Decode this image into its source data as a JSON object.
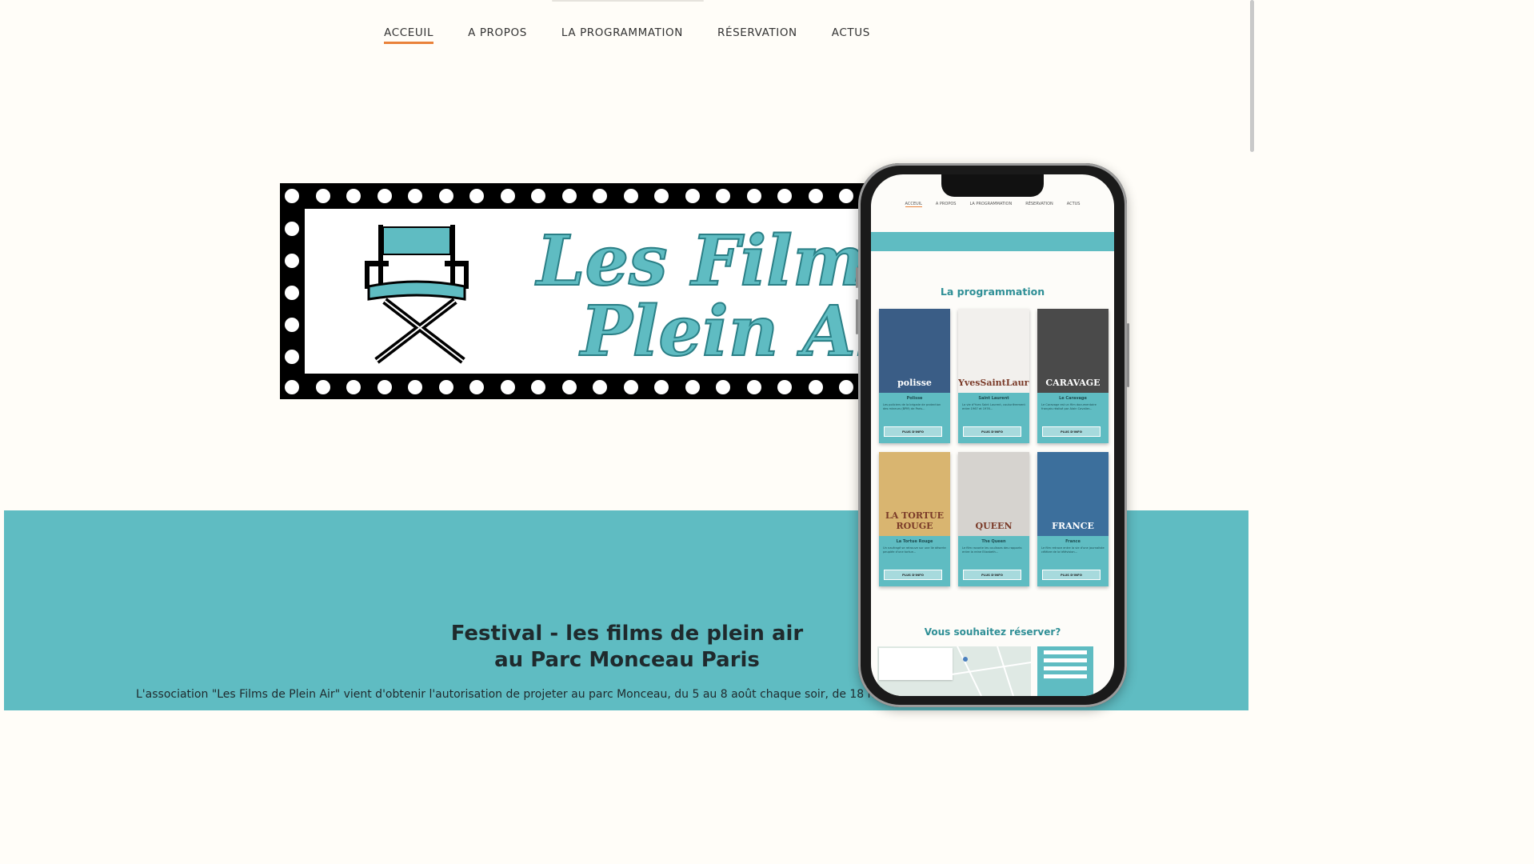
{
  "nav": {
    "items": [
      {
        "label": "ACCEUIL"
      },
      {
        "label": "A PROPOS"
      },
      {
        "label": "LA PROGRAMMATION"
      },
      {
        "label": "RÉSERVATION"
      },
      {
        "label": "ACTUS"
      }
    ]
  },
  "banner": {
    "line1": "Les Films",
    "line2": "Plein Air"
  },
  "hero": {
    "title_line1": "Festival - les films de plein air",
    "title_line2": "au Parc Monceau Paris",
    "intro": "L'association \"Les Films de Plein Air\" vient d'obtenir l'autorisation de projeter au parc Monceau, du 5 au 8 août chaque soir, de 18 h à minuit"
  },
  "mockup": {
    "nav": [
      "ACCEUIL",
      "A PROPOS",
      "LA PROGRAMMATION",
      "RÉSERVATION",
      "ACTUS"
    ],
    "section_title": "La programmation",
    "button_label": "PLUS D'INFO",
    "films": [
      {
        "title": "Polisse",
        "poster_text": "polisse",
        "bg": "#3a5d86",
        "desc": "Les policiers de la brigade de protection des mineurs (BPM) de Paris..."
      },
      {
        "title": "Saint Laurent",
        "poster_text": "YvesSaintLaurent",
        "bg": "#f2f0ed",
        "desc": "La vie d'Yves Saint Laurent, couturièrement entre 1967 et 1976..."
      },
      {
        "title": "Le Caravage",
        "poster_text": "CARAVAGE",
        "bg": "#4a4a4a",
        "desc": "Le Caravage est un film documentaire français réalisé par Alain Cavalier..."
      },
      {
        "title": "La Tortue Rouge",
        "poster_text": "LA TORTUE ROUGE",
        "bg": "#d9b570",
        "desc": "Un naufragé se retrouve sur une île déserte peuplée d'une tortue..."
      },
      {
        "title": "The Queen",
        "poster_text": "QUEEN",
        "bg": "#d6d3cf",
        "desc": "Le film raconte les coulisses des rapports entre la reine Elizabeth..."
      },
      {
        "title": "France",
        "poster_text": "FRANCE",
        "bg": "#3c6f9c",
        "desc": "Le film retrace entre la vie d'une journaliste célèbre de la télévision..."
      }
    ],
    "reserve_title": "Vous souhaitez réserver?"
  },
  "colors": {
    "teal": "#5fbcc2",
    "accent": "#e9823a",
    "background": "#fffdf8"
  }
}
